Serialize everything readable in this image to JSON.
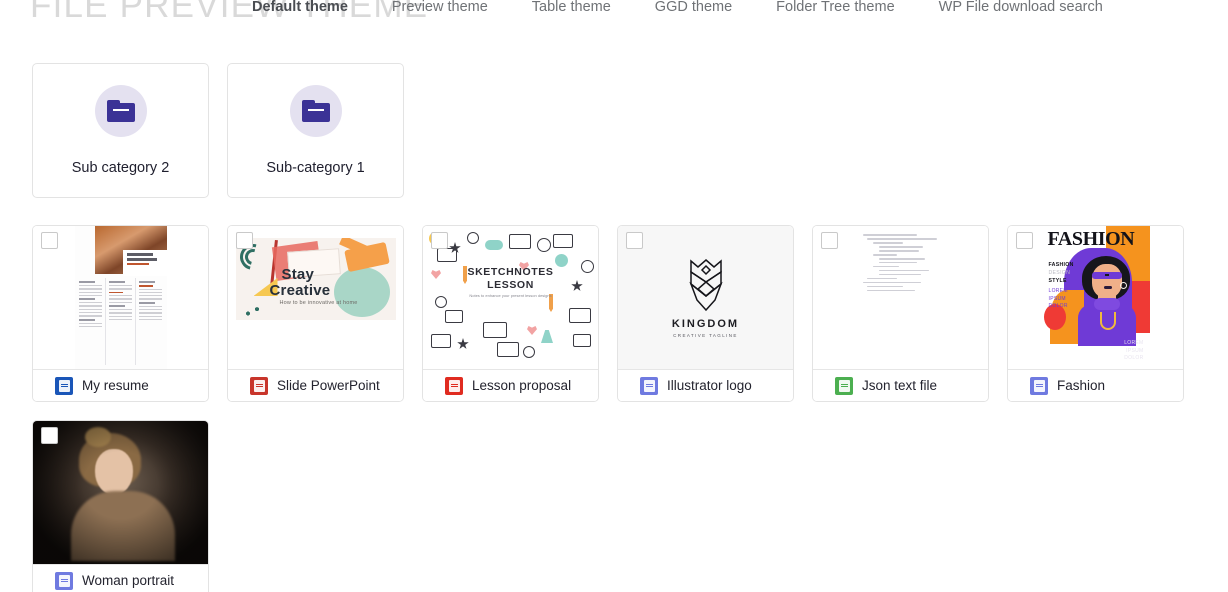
{
  "header": {
    "ghost_title": "FILE PREVIEW THEME",
    "nav_items": [
      {
        "label": "Default theme",
        "active": true
      },
      {
        "label": "Preview theme",
        "active": false
      },
      {
        "label": "Table theme",
        "active": false
      },
      {
        "label": "GGD theme",
        "active": false
      },
      {
        "label": "Folder Tree theme",
        "active": false
      },
      {
        "label": "WP File download search",
        "active": false
      }
    ]
  },
  "folders": [
    {
      "name": "Sub category 2",
      "icon": "folder-icon"
    },
    {
      "name": "Sub-category 1",
      "icon": "folder-icon"
    }
  ],
  "files": [
    {
      "name": "My resume",
      "icon": "word-document-icon",
      "icon_color": "#1a56b8",
      "thumbnail": "resume-thumbnail",
      "checkbox_checked": false
    },
    {
      "name": "Slide PowerPoint",
      "icon": "powerpoint-document-icon",
      "icon_color": "#c8352b",
      "thumbnail": "stay-creative-slide-thumbnail",
      "checkbox_checked": false,
      "thumbnail_text": {
        "line1": "Stay",
        "line2": "Creative",
        "subtitle": "How to be innovative at home"
      }
    },
    {
      "name": "Lesson proposal",
      "icon": "pdf-document-icon",
      "icon_color": "#e02b20",
      "thumbnail": "sketchnotes-thumbnail",
      "checkbox_checked": false,
      "thumbnail_text": {
        "line1": "SKETCHNOTES",
        "line2": "LESSON",
        "subtitle": "Notes to enhance your present lesson designs"
      }
    },
    {
      "name": "Illustrator logo",
      "icon": "image-file-icon",
      "icon_color": "#6f7ae0",
      "thumbnail": "kingdom-logo-thumbnail",
      "checkbox_checked": false,
      "thumbnail_text": {
        "line1": "KINGDOM",
        "subtitle": "CREATIVE TAGLINE"
      }
    },
    {
      "name": "Json text file",
      "icon": "text-file-icon",
      "icon_color": "#4caf50",
      "thumbnail": "json-code-thumbnail",
      "checkbox_checked": false
    },
    {
      "name": "Fashion",
      "icon": "image-file-icon",
      "icon_color": "#6f7ae0",
      "thumbnail": "fashion-magazine-thumbnail",
      "checkbox_checked": false,
      "thumbnail_text": {
        "title": "FASHION",
        "side1": "FASHION",
        "side2": "DESIGN",
        "side3": "STYLE",
        "lorem1": "LOREM",
        "lorem2": "IPSUM",
        "lorem3": "DOLOR",
        "bottom1": "LOREM",
        "bottom2": "IPSUM",
        "bottom3": "DOLOR"
      }
    },
    {
      "name": "Woman portrait",
      "icon": "image-file-icon",
      "icon_color": "#6f7ae0",
      "thumbnail": "woman-portrait-thumbnail",
      "checkbox_checked": false
    }
  ],
  "colors": {
    "folder_icon": "#3b3296",
    "folder_circle": "#e4e1f0",
    "card_border": "#e3e3e3",
    "ghost_title": "#d9d9d9",
    "nav_text": "#6f7276",
    "nav_active_text": "#4a4d52"
  }
}
